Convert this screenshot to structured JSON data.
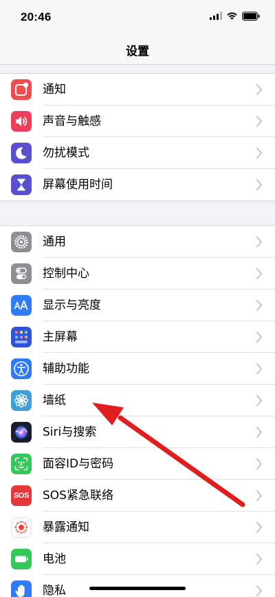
{
  "status_bar": {
    "time": "20:46"
  },
  "nav": {
    "title": "设置"
  },
  "group1": [
    {
      "label": "通知",
      "icon": "notifications-icon",
      "color": "#f04e4e"
    },
    {
      "label": "声音与触感",
      "icon": "speaker-icon",
      "color": "#ef3f5a"
    },
    {
      "label": "勿扰模式",
      "icon": "moon-icon",
      "color": "#5a4fcf"
    },
    {
      "label": "屏幕使用时间",
      "icon": "hourglass-icon",
      "color": "#5a4fcf"
    }
  ],
  "group2": [
    {
      "label": "通用",
      "icon": "gear-icon",
      "color": "#8e8e93"
    },
    {
      "label": "控制中心",
      "icon": "toggles-icon",
      "color": "#8e8e93"
    },
    {
      "label": "显示与亮度",
      "icon": "text-size-icon",
      "color": "#2f7cf6"
    },
    {
      "label": "主屏幕",
      "icon": "home-grid-icon",
      "color": "#2f54d9"
    },
    {
      "label": "辅助功能",
      "icon": "accessibility-icon",
      "color": "#2f7cf6"
    },
    {
      "label": "墙纸",
      "icon": "flower-icon",
      "color": "#3ea0d8"
    },
    {
      "label": "Siri与搜索",
      "icon": "siri-icon",
      "color": "#1c1c2e"
    },
    {
      "label": "面容ID与密码",
      "icon": "face-id-icon",
      "color": "#34c759"
    },
    {
      "label": "SOS紧急联络",
      "icon": "sos-icon",
      "color": "#e5383b"
    },
    {
      "label": "暴露通知",
      "icon": "exposure-icon",
      "color": "#ffffff"
    },
    {
      "label": "电池",
      "icon": "battery-icon",
      "color": "#34c759"
    },
    {
      "label": "隐私",
      "icon": "hand-icon",
      "color": "#2f7cf6"
    }
  ],
  "sos_text": "SOS",
  "accent": {
    "annotation_arrow": "#e01e1e",
    "chevron": "#c4c4c7"
  }
}
